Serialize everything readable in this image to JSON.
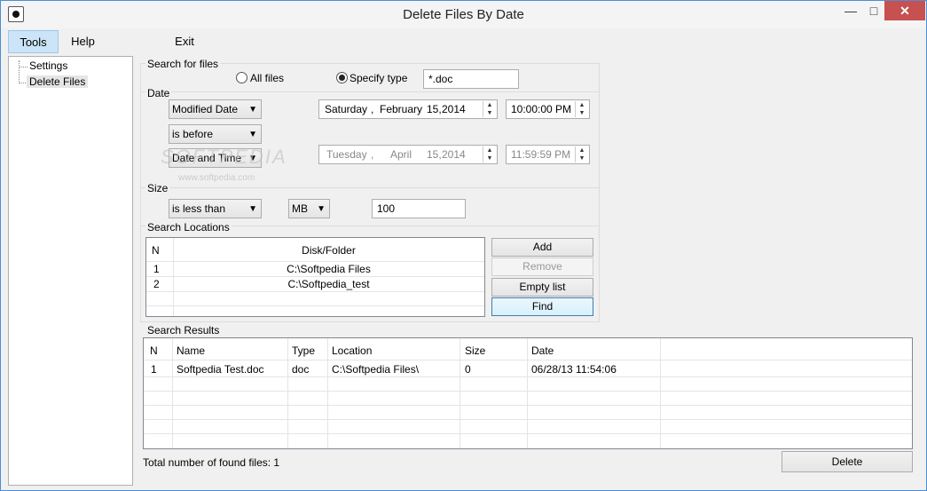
{
  "window": {
    "title": "Delete Files By Date",
    "minimize_glyph": "—",
    "maximize_glyph": "□",
    "close_glyph": "✕"
  },
  "menu": {
    "tools": "Tools",
    "help": "Help",
    "exit": "Exit"
  },
  "tree": {
    "items": [
      {
        "label": "Settings"
      },
      {
        "label": "Delete Files"
      }
    ]
  },
  "search_for_files": {
    "group_label": "Search for files",
    "all_files_label": "All files",
    "specify_type_label": "Specify type",
    "selected": "Specify type",
    "file_type_value": "*.doc"
  },
  "date": {
    "group_label": "Date",
    "date_field": "Modified Date",
    "condition": "is before",
    "compare_mode": "Date and Time",
    "date1": {
      "weekday": "Saturday",
      "sep": ",",
      "month": "February",
      "day": "15,",
      "year": "2014"
    },
    "time1": "10:00:00 PM",
    "date2": {
      "weekday": "Tuesday",
      "sep": ",",
      "month": "April",
      "day": "15,",
      "year": "2014"
    },
    "time2": "11:59:59 PM"
  },
  "size": {
    "group_label": "Size",
    "condition": "is less than",
    "unit": "MB",
    "value": "100"
  },
  "search_locations": {
    "group_label": "Search Locations",
    "columns": [
      "N",
      "Disk/Folder"
    ],
    "rows": [
      {
        "n": "1",
        "folder": "C:\\Softpedia Files"
      },
      {
        "n": "2",
        "folder": "C:\\Softpedia_test"
      }
    ],
    "buttons": {
      "add": "Add",
      "remove": "Remove",
      "empty_list": "Empty list",
      "find": "Find"
    }
  },
  "search_results": {
    "group_label": "Search Results",
    "columns": [
      "N",
      "Name",
      "Type",
      "Location",
      "Size",
      "Date"
    ],
    "rows": [
      {
        "n": "1",
        "name": "Softpedia Test.doc",
        "type": "doc",
        "location": "C:\\Softpedia Files\\",
        "size": "0",
        "date": "06/28/13 11:54:06"
      }
    ],
    "total_label": "Total number of found files: 1",
    "delete_button": "Delete"
  },
  "watermark": {
    "text": "SOFTPEDIA",
    "url": "www.softpedia.com"
  },
  "colors": {
    "accent_border": "#4a8dd6",
    "close_button": "#c75050",
    "menu_active": "#cce4f7",
    "find_button": "#d9f0fc"
  }
}
